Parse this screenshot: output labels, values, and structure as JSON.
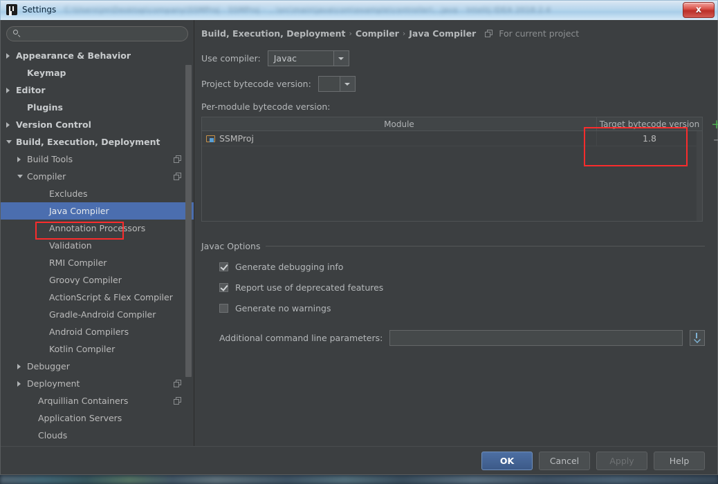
{
  "window": {
    "title": "Settings",
    "blurred_title_suffix": "C:\\Users\\jm\\Desktop\\company\\SSMProj - SSMProj - ...\\src\\main\\java\\com\\example\\controller\\...java - Intellij IDEA  2018.2.4",
    "close_label": "x",
    "app_icon": "intellij-idea-icon"
  },
  "sidebar": {
    "search": {
      "value": "",
      "placeholder": ""
    },
    "items": [
      {
        "label": "Appearance & Behavior",
        "level": 0,
        "arrow": "collapsed",
        "copy": false,
        "selected": false
      },
      {
        "label": "Keymap",
        "level": 0,
        "arrow": "none",
        "copy": false,
        "selected": false
      },
      {
        "label": "Editor",
        "level": 0,
        "arrow": "collapsed",
        "copy": false,
        "selected": false
      },
      {
        "label": "Plugins",
        "level": 0,
        "arrow": "none",
        "copy": false,
        "selected": false
      },
      {
        "label": "Version Control",
        "level": 0,
        "arrow": "collapsed",
        "copy": false,
        "selected": false
      },
      {
        "label": "Build, Execution, Deployment",
        "level": 0,
        "arrow": "expanded",
        "copy": false,
        "selected": false
      },
      {
        "label": "Build Tools",
        "level": 1,
        "arrow": "collapsed",
        "copy": true,
        "selected": false
      },
      {
        "label": "Compiler",
        "level": 1,
        "arrow": "expanded",
        "copy": true,
        "selected": false
      },
      {
        "label": "Excludes",
        "level": 2,
        "arrow": "none",
        "copy": false,
        "selected": false
      },
      {
        "label": "Java Compiler",
        "level": 2,
        "arrow": "none",
        "copy": false,
        "selected": true
      },
      {
        "label": "Annotation Processors",
        "level": 2,
        "arrow": "none",
        "copy": false,
        "selected": false
      },
      {
        "label": "Validation",
        "level": 2,
        "arrow": "none",
        "copy": false,
        "selected": false
      },
      {
        "label": "RMI Compiler",
        "level": 2,
        "arrow": "none",
        "copy": false,
        "selected": false
      },
      {
        "label": "Groovy Compiler",
        "level": 2,
        "arrow": "none",
        "copy": false,
        "selected": false
      },
      {
        "label": "ActionScript & Flex Compiler",
        "level": 2,
        "arrow": "none",
        "copy": false,
        "selected": false
      },
      {
        "label": "Gradle-Android Compiler",
        "level": 2,
        "arrow": "none",
        "copy": false,
        "selected": false
      },
      {
        "label": "Android Compilers",
        "level": 2,
        "arrow": "none",
        "copy": false,
        "selected": false
      },
      {
        "label": "Kotlin Compiler",
        "level": 2,
        "arrow": "none",
        "copy": false,
        "selected": false
      },
      {
        "label": "Debugger",
        "level": 1,
        "arrow": "collapsed",
        "copy": false,
        "selected": false
      },
      {
        "label": "Deployment",
        "level": 1,
        "arrow": "collapsed",
        "copy": true,
        "selected": false
      },
      {
        "label": "Arquillian Containers",
        "level": 1,
        "arrow": "none",
        "copy": true,
        "selected": false
      },
      {
        "label": "Application Servers",
        "level": 1,
        "arrow": "none",
        "copy": false,
        "selected": false
      },
      {
        "label": "Clouds",
        "level": 1,
        "arrow": "none",
        "copy": false,
        "selected": false
      }
    ]
  },
  "main": {
    "breadcrumb": [
      "Build, Execution, Deployment",
      "Compiler",
      "Java Compiler"
    ],
    "breadcrumb_separator": "›",
    "scope_label": "For current project",
    "use_compiler": {
      "label": "Use compiler:",
      "value": "Javac"
    },
    "project_bytecode": {
      "label": "Project bytecode version:",
      "value": ""
    },
    "per_module_label": "Per-module bytecode version:",
    "table": {
      "columns": [
        "Module",
        "Target bytecode version"
      ],
      "rows": [
        {
          "module": "SSMProj",
          "target": "1.8"
        }
      ],
      "add_label": "+",
      "remove_label": "–"
    },
    "javac_options": {
      "legend": "Javac Options",
      "checkboxes": [
        {
          "label": "Generate debugging info",
          "checked": true
        },
        {
          "label": "Report use of deprecated features",
          "checked": true
        },
        {
          "label": "Generate no warnings",
          "checked": false
        }
      ],
      "params": {
        "label": "Additional command line parameters:",
        "value": "",
        "placeholder": ""
      }
    }
  },
  "footer": {
    "ok": "OK",
    "cancel": "Cancel",
    "apply": "Apply",
    "help": "Help"
  },
  "colors": {
    "accent_selection": "#4b6eaf",
    "annotation_red": "#fb2c2c",
    "panel_bg": "#3c3f41",
    "add_green": "#4caf50"
  }
}
